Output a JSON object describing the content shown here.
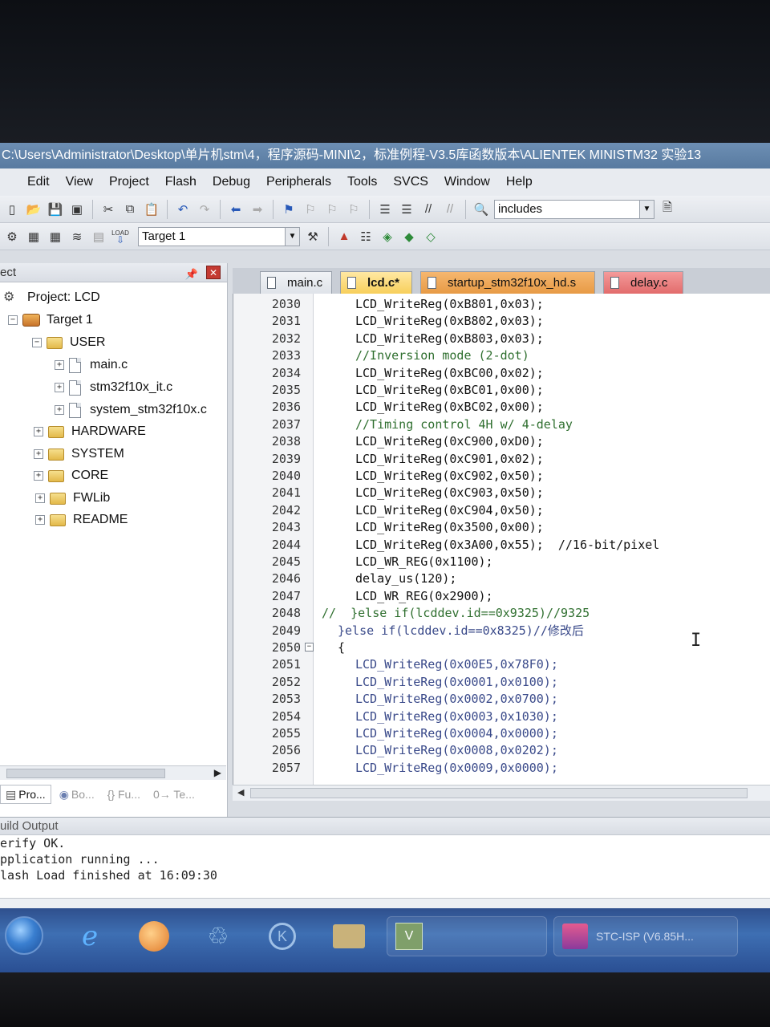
{
  "window": {
    "title": "C:\\Users\\Administrator\\Desktop\\单片机stm\\4，程序源码-MINI\\2，标准例程-V3.5库函数版本\\ALIENTEK MINISTM32 实验13"
  },
  "menu": [
    "Edit",
    "View",
    "Project",
    "Flash",
    "Debug",
    "Peripherals",
    "Tools",
    "SVCS",
    "Window",
    "Help"
  ],
  "toolbar": {
    "find_combo_value": "includes",
    "target_combo_value": "Target 1",
    "load_label": "LOAD"
  },
  "project_panel": {
    "header": "ect",
    "tree": [
      {
        "label": "Project: LCD",
        "kind": "project"
      },
      {
        "label": "Target 1",
        "kind": "target"
      },
      {
        "label": "USER",
        "kind": "folder"
      },
      {
        "label": "main.c",
        "kind": "file"
      },
      {
        "label": "stm32f10x_it.c",
        "kind": "file"
      },
      {
        "label": "system_stm32f10x.c",
        "kind": "file"
      },
      {
        "label": "HARDWARE",
        "kind": "folder"
      },
      {
        "label": "SYSTEM",
        "kind": "folder"
      },
      {
        "label": "CORE",
        "kind": "folder"
      },
      {
        "label": "FWLib",
        "kind": "folder"
      },
      {
        "label": "README",
        "kind": "folder"
      }
    ],
    "tabs": [
      "Pro...",
      "Bo...",
      "{} Fu...",
      "0→ Te..."
    ]
  },
  "editor_tabs": [
    "main.c",
    "lcd.c*",
    "startup_stm32f10x_hd.s",
    "delay.c"
  ],
  "code_lines": [
    {
      "n": "2030",
      "text": "LCD_WriteReg(0xB801,0x03);",
      "indent": 1
    },
    {
      "n": "2031",
      "text": "LCD_WriteReg(0xB802,0x03);",
      "indent": 1
    },
    {
      "n": "2032",
      "text": "LCD_WriteReg(0xB803,0x03);",
      "indent": 1
    },
    {
      "n": "2033",
      "text": "//Inversion mode (2-dot)",
      "indent": 1,
      "comment": true
    },
    {
      "n": "2034",
      "text": "LCD_WriteReg(0xBC00,0x02);",
      "indent": 1
    },
    {
      "n": "2035",
      "text": "LCD_WriteReg(0xBC01,0x00);",
      "indent": 1
    },
    {
      "n": "2036",
      "text": "LCD_WriteReg(0xBC02,0x00);",
      "indent": 1
    },
    {
      "n": "2037",
      "text": "//Timing control 4H w/ 4-delay",
      "indent": 1,
      "comment": true
    },
    {
      "n": "2038",
      "text": "LCD_WriteReg(0xC900,0xD0);",
      "indent": 1
    },
    {
      "n": "2039",
      "text": "LCD_WriteReg(0xC901,0x02);",
      "indent": 1
    },
    {
      "n": "2040",
      "text": "LCD_WriteReg(0xC902,0x50);",
      "indent": 1
    },
    {
      "n": "2041",
      "text": "LCD_WriteReg(0xC903,0x50);",
      "indent": 1
    },
    {
      "n": "2042",
      "text": "LCD_WriteReg(0xC904,0x50);",
      "indent": 1
    },
    {
      "n": "2043",
      "text": "LCD_WriteReg(0x3500,0x00);",
      "indent": 1
    },
    {
      "n": "2044",
      "text": "LCD_WriteReg(0x3A00,0x55);  //16-bit/pixel",
      "indent": 1
    },
    {
      "n": "2045",
      "text": "LCD_WR_REG(0x1100);",
      "indent": 1
    },
    {
      "n": "2046",
      "text": "delay_us(120);",
      "indent": 1
    },
    {
      "n": "2047",
      "text": "LCD_WR_REG(0x2900);",
      "indent": 1
    },
    {
      "n": "2048",
      "text": "//  }else if(lcddev.id==0x9325)//9325",
      "indent": 0,
      "comment": true
    },
    {
      "n": "2049",
      "text": "}else if(lcddev.id==0x8325)//修改后",
      "indent": 2,
      "dim": true
    },
    {
      "n": "2050",
      "text": "{",
      "indent": 2,
      "fold": true
    },
    {
      "n": "2051",
      "text": "LCD_WriteReg(0x00E5,0x78F0);",
      "indent": 1,
      "dim": true
    },
    {
      "n": "2052",
      "text": "LCD_WriteReg(0x0001,0x0100);",
      "indent": 1,
      "dim": true
    },
    {
      "n": "2053",
      "text": "LCD_WriteReg(0x0002,0x0700);",
      "indent": 1,
      "dim": true
    },
    {
      "n": "2054",
      "text": "LCD_WriteReg(0x0003,0x1030);",
      "indent": 1,
      "dim": true
    },
    {
      "n": "2055",
      "text": "LCD_WriteReg(0x0004,0x0000);",
      "indent": 1,
      "dim": true
    },
    {
      "n": "2056",
      "text": "LCD_WriteReg(0x0008,0x0202);",
      "indent": 1,
      "dim": true
    },
    {
      "n": "2057",
      "text": "LCD_WriteReg(0x0009,0x0000);",
      "indent": 1,
      "dim": true
    }
  ],
  "build_output": {
    "header": "uild Output",
    "lines": [
      "erify OK.",
      "pplication running ...",
      "lash Load finished at 16:09:30"
    ]
  },
  "taskbar": {
    "items": [
      "",
      "",
      "",
      "",
      "",
      "",
      "",
      "STC-ISP (V6.85H..."
    ]
  }
}
